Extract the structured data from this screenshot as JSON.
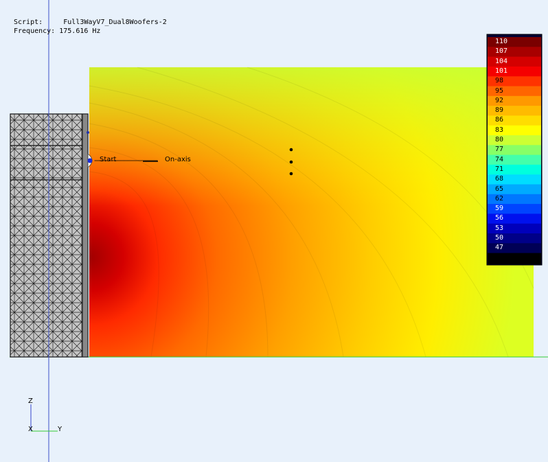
{
  "info": {
    "script_label": "Script:",
    "script_value": "Full3WayV7_Dual8Woofers-2",
    "freq_label": "Frequency:",
    "freq_value": "175.616 Hz"
  },
  "legend": {
    "values": [
      "110",
      "107",
      "104",
      "101",
      "98",
      "95",
      "92",
      "89",
      "86",
      "83",
      "80",
      "77",
      "74",
      "71",
      "68",
      "65",
      "62",
      "59",
      "56",
      "53",
      "50",
      "47"
    ],
    "colors": [
      "#7a0000",
      "#a80000",
      "#d40000",
      "#f50000",
      "#ff3300",
      "#ff6600",
      "#ff9900",
      "#ffbb00",
      "#ffdd00",
      "#ffff00",
      "#ccff33",
      "#88ff66",
      "#44ffaa",
      "#00ffdd",
      "#00ddff",
      "#00aaff",
      "#0077ff",
      "#0044ff",
      "#0011ee",
      "#0000bb",
      "#000088",
      "#000055"
    ]
  },
  "probe": {
    "start_label": "Start",
    "end_label": "On-axis"
  },
  "axes": {
    "z": "Z",
    "x": "X",
    "y": "Y"
  }
}
